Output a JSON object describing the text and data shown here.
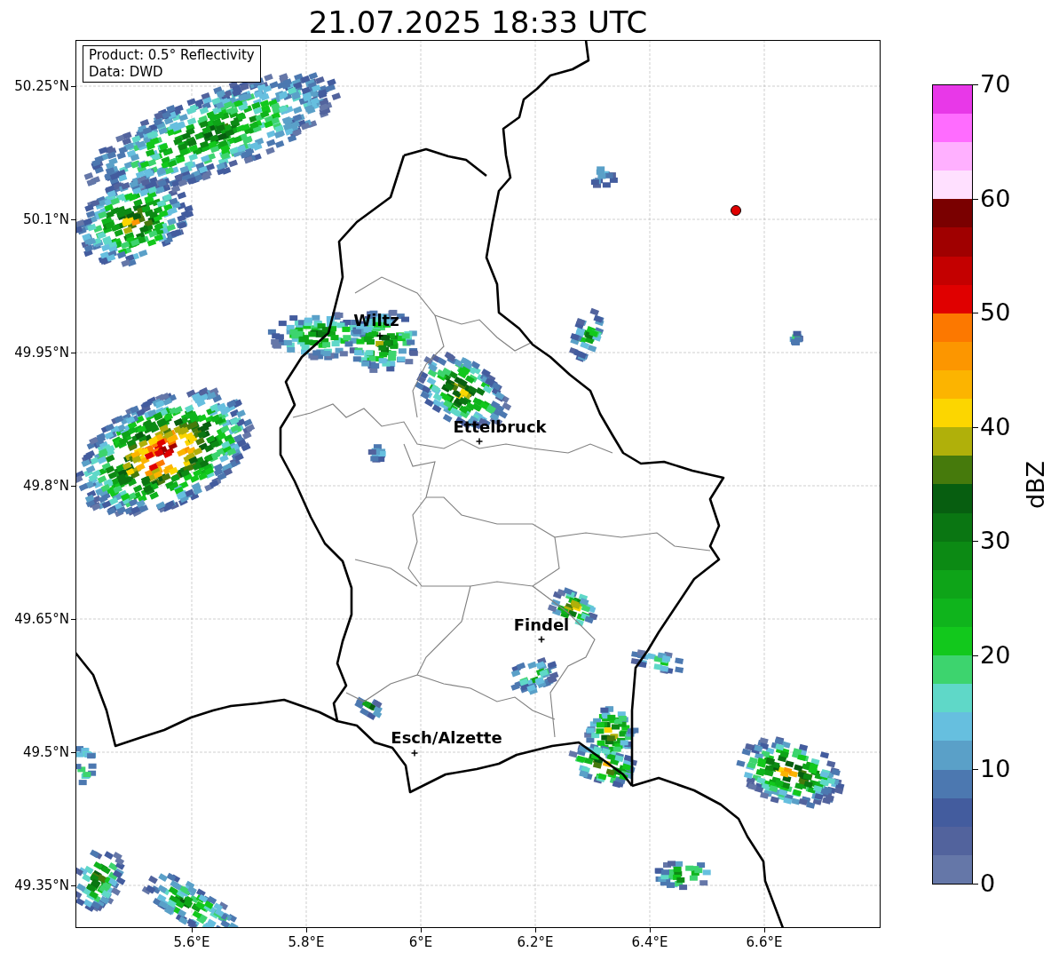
{
  "title": "21.07.2025 18:33 UTC",
  "info_box": [
    "Product: 0.5° Reflectivity",
    "Data: DWD"
  ],
  "cities": [
    {
      "name": "Wiltz"
    },
    {
      "name": "Ettelbruck"
    },
    {
      "name": "Findel"
    },
    {
      "name": "Esch/Alzette"
    }
  ],
  "x_ticks": [
    "5.6°E",
    "5.8°E",
    "6°E",
    "6.2°E",
    "6.4°E",
    "6.6°E"
  ],
  "y_ticks": [
    "50.25°N",
    "50.1°N",
    "49.95°N",
    "49.8°N",
    "49.65°N",
    "49.5°N",
    "49.35°N"
  ],
  "colorbar": {
    "label": "dBZ",
    "ticks": [
      "70",
      "60",
      "50",
      "40",
      "30",
      "20",
      "10",
      "0"
    ],
    "bins": [
      {
        "color": "#6577a8"
      },
      {
        "color": "#52639d"
      },
      {
        "color": "#435c9e"
      },
      {
        "color": "#4c78b0"
      },
      {
        "color": "#5aa0c8"
      },
      {
        "color": "#66bfdf"
      },
      {
        "color": "#5fd8c8"
      },
      {
        "color": "#3dd46e"
      },
      {
        "color": "#12c81c"
      },
      {
        "color": "#0fb41c"
      },
      {
        "color": "#0ea418"
      },
      {
        "color": "#0c8a14"
      },
      {
        "color": "#0a7612"
      },
      {
        "color": "#075e10"
      },
      {
        "color": "#467a0c"
      },
      {
        "color": "#b0b00a"
      },
      {
        "color": "#fcd600"
      },
      {
        "color": "#fcb400"
      },
      {
        "color": "#fc9600"
      },
      {
        "color": "#fc7800"
      },
      {
        "color": "#e00000"
      },
      {
        "color": "#c40000"
      },
      {
        "color": "#a00000"
      },
      {
        "color": "#7a0000"
      },
      {
        "color": "#ffe0ff"
      },
      {
        "color": "#ffb0ff"
      },
      {
        "color": "#ff6cff"
      },
      {
        "color": "#e838e8"
      }
    ]
  }
}
